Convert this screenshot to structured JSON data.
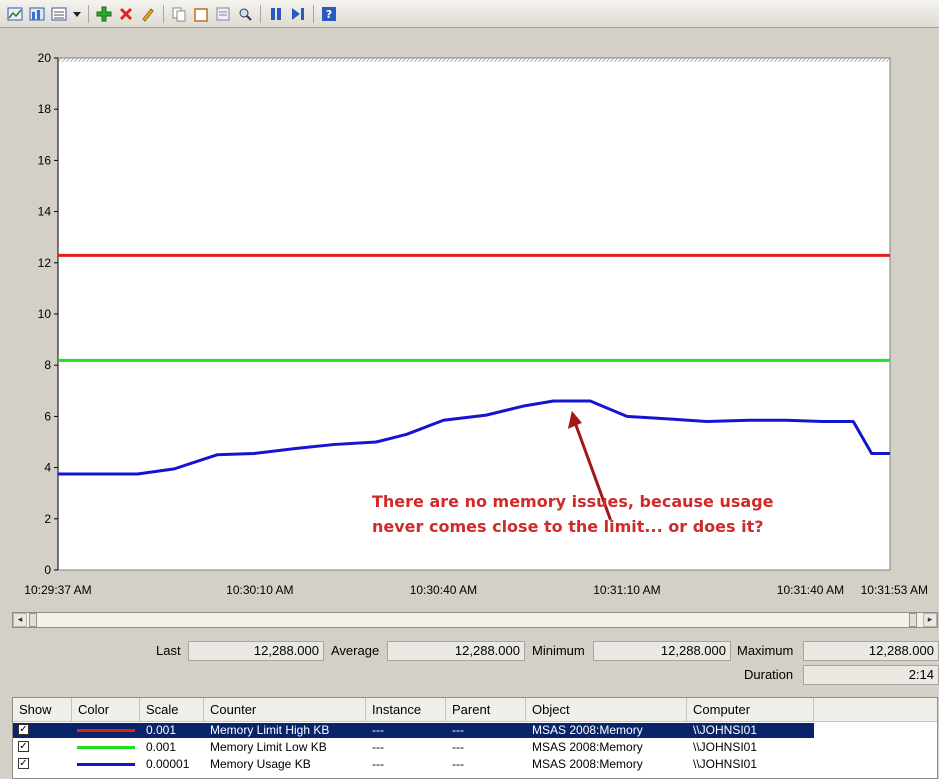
{
  "toolbar": {
    "icons": [
      "view-graph-icon",
      "view-histogram-icon",
      "view-report-icon",
      "dropdown-icon",
      "add-counter-icon",
      "delete-counter-icon",
      "highlight-icon",
      "copy-properties-icon",
      "paste-counter-list-icon",
      "properties-icon",
      "zoom-icon",
      "freeze-display-icon",
      "update-data-icon",
      "help-icon"
    ]
  },
  "chart_data": {
    "type": "line",
    "ylim": [
      0,
      20
    ],
    "yticks": [
      "0",
      "2",
      "4",
      "6",
      "8",
      "10",
      "12",
      "14",
      "16",
      "18",
      "20"
    ],
    "xtick_labels": [
      "10:29:37 AM",
      "10:30:10 AM",
      "10:30:40 AM",
      "10:31:10 AM",
      "10:31:40 AM",
      "10:31:53 AM"
    ],
    "x_range": [
      "10:29:37 AM",
      "10:31:53 AM"
    ],
    "series": [
      {
        "name": "Memory Limit High KB",
        "color": "#e02020",
        "x": [
          "10:29:37",
          "10:31:53"
        ],
        "y": [
          12.29,
          12.29
        ]
      },
      {
        "name": "Memory Limit Low KB",
        "color": "#20e020",
        "x": [
          "10:29:37",
          "10:31:53"
        ],
        "y": [
          8.19,
          8.19
        ]
      },
      {
        "name": "Memory Usage KB",
        "color": "#1515d0",
        "x": [
          "10:29:37",
          "10:29:43",
          "10:29:50",
          "10:29:56",
          "10:30:03",
          "10:30:09",
          "10:30:16",
          "10:30:22",
          "10:30:29",
          "10:30:34",
          "10:30:40",
          "10:30:47",
          "10:30:53",
          "10:30:58",
          "10:31:04",
          "10:31:10",
          "10:31:17",
          "10:31:23",
          "10:31:30",
          "10:31:36",
          "10:31:42",
          "10:31:47",
          "10:31:50",
          "10:31:53"
        ],
        "y": [
          3.75,
          3.75,
          3.75,
          3.95,
          4.5,
          4.55,
          4.75,
          4.9,
          5.0,
          5.3,
          5.85,
          6.05,
          6.4,
          6.6,
          6.6,
          6.0,
          5.9,
          5.8,
          5.85,
          5.85,
          5.8,
          5.8,
          4.55,
          4.55
        ]
      }
    ],
    "annotation": {
      "lines": [
        "There are no memory issues, because usage",
        "never comes close to the limit... or does it?"
      ],
      "color": "#d02a2a"
    },
    "grid": false
  },
  "stats": {
    "last_label": "Last",
    "last_value": "12,288.000",
    "average_label": "Average",
    "average_value": "12,288.000",
    "minimum_label": "Minimum",
    "minimum_value": "12,288.000",
    "maximum_label": "Maximum",
    "maximum_value": "12,288.000",
    "duration_label": "Duration",
    "duration_value": "2:14"
  },
  "legend": {
    "columns": [
      "Show",
      "Color",
      "Scale",
      "Counter",
      "Instance",
      "Parent",
      "Object",
      "Computer"
    ],
    "rows": [
      {
        "color": "#e02020",
        "scale": "0.001",
        "counter": "Memory Limit High KB",
        "instance": "---",
        "parent": "---",
        "object": "MSAS 2008:Memory",
        "computer": "\\\\JOHNSI01",
        "selected": true
      },
      {
        "color": "#20e020",
        "scale": "0.001",
        "counter": "Memory Limit Low KB",
        "instance": "---",
        "parent": "---",
        "object": "MSAS 2008:Memory",
        "computer": "\\\\JOHNSI01",
        "selected": false
      },
      {
        "color": "#1515d0",
        "scale": "0.00001",
        "counter": "Memory Usage KB",
        "instance": "---",
        "parent": "---",
        "object": "MSAS 2008:Memory",
        "computer": "\\\\JOHNSI01",
        "selected": false
      }
    ]
  }
}
